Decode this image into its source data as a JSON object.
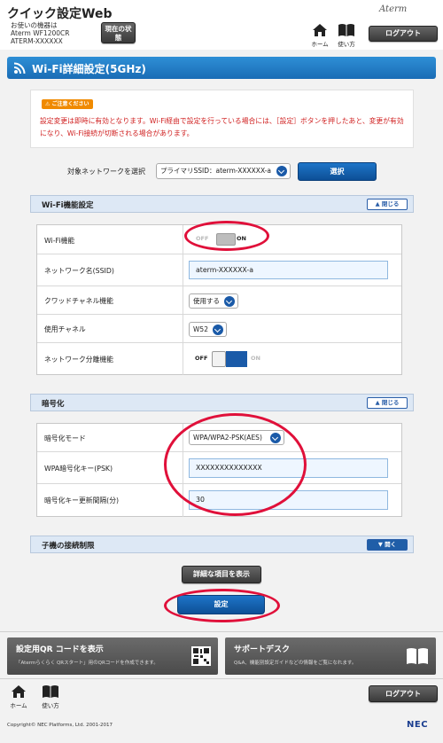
{
  "header": {
    "title": "クイック設定Web",
    "device_label": "お使いの機器は",
    "model": "Aterm WF1200CR",
    "device_name": "ATERM-XXXXXX",
    "status_button": "現在の状態",
    "brand": "Aterm",
    "home_label": "ホーム",
    "manual_label": "使い方",
    "logout_label": "ログアウト"
  },
  "page_title": "Wi-Fi詳細設定(5GHz)",
  "notice": {
    "badge": "ご注意ください",
    "text": "設定変更は即時に有効となります。Wi-Fi経由で設定を行っている場合には、［設定］ボタンを押したあと、変更が有効になり、Wi-Fi接続が切断される場合があります。"
  },
  "network_select": {
    "label": "対象ネットワークを選択",
    "value": "プライマリSSID：aterm-XXXXXX-a",
    "button": "選択"
  },
  "wifi_section": {
    "title": "Wi-Fi機能設定",
    "collapse_label": "閉じる",
    "rows": {
      "wifi": {
        "label": "Wi-Fi機能",
        "off": "OFF",
        "on": "ON",
        "state": "ON"
      },
      "ssid": {
        "label": "ネットワーク名(SSID)",
        "value": "aterm-XXXXXX-a"
      },
      "quad": {
        "label": "クワッドチャネル機能",
        "value": "使用する"
      },
      "channel": {
        "label": "使用チャネル",
        "value": "W52"
      },
      "separation": {
        "label": "ネットワーク分離機能",
        "off": "OFF",
        "on": "ON",
        "state": "OFF"
      }
    }
  },
  "encryption_section": {
    "title": "暗号化",
    "collapse_label": "閉じる",
    "rows": {
      "mode": {
        "label": "暗号化モード",
        "value": "WPA/WPA2-PSK(AES)"
      },
      "psk": {
        "label": "WPA暗号化キー(PSK)",
        "value": "XXXXXXXXXXXXXX"
      },
      "interval": {
        "label": "暗号化キー更新間隔(分)",
        "value": "30"
      }
    }
  },
  "child_section": {
    "title": "子機の接続制限",
    "expand_label": "開く"
  },
  "show_details_button": "詳細な項目を表示",
  "submit_button": "設定",
  "cards": {
    "qr": {
      "title": "設定用QR コードを表示",
      "subtitle": "「Atermらくらく QRスタート」用のQRコードを作成できます。"
    },
    "support": {
      "title": "サポートデスク",
      "subtitle": "Q&A、機能別設定ガイドなどの情報をご覧になれます。"
    }
  },
  "footer": {
    "home_label": "ホーム",
    "manual_label": "使い方",
    "logout_label": "ログアウト",
    "copyright": "Copyright© NEC Platforms, Ltd. 2001-2017",
    "brand": "NEC"
  },
  "colors": {
    "accent_blue": "#1a6cb5",
    "highlight_red": "#e0103a",
    "notice_red": "#d02020"
  }
}
